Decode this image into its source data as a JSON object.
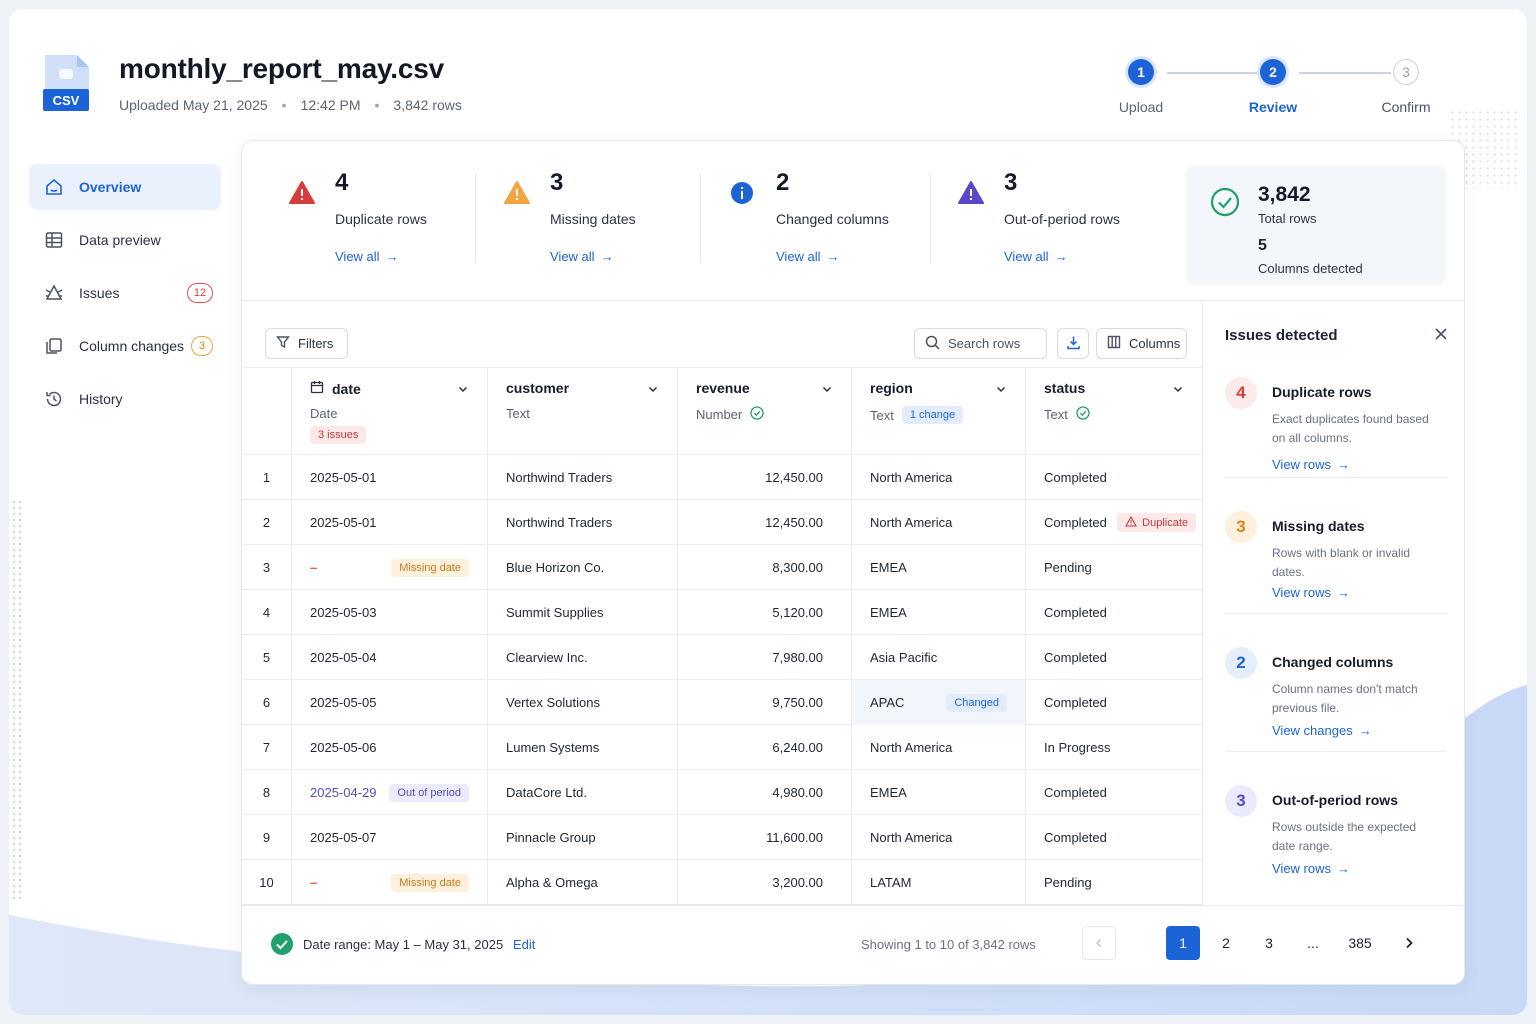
{
  "file": {
    "icon_label": "CSV",
    "name": "monthly_report_may.csv",
    "uploaded": "Uploaded May 21, 2025",
    "time": "12:42 PM",
    "rows": "3,842 rows",
    "separator": "•"
  },
  "stepper": [
    {
      "num": "1",
      "label": "Upload",
      "state": "done"
    },
    {
      "num": "2",
      "label": "Review",
      "state": "active"
    },
    {
      "num": "3",
      "label": "Confirm",
      "state": "todo"
    }
  ],
  "sidebar": {
    "items": [
      {
        "label": "Overview",
        "icon": "home-icon",
        "active": true
      },
      {
        "label": "Data preview",
        "icon": "table-icon"
      },
      {
        "label": "Issues",
        "icon": "bug-icon",
        "badge": "12"
      },
      {
        "label": "Column changes",
        "icon": "copy-icon",
        "badge": "3"
      },
      {
        "label": "History",
        "icon": "history-icon"
      }
    ]
  },
  "summary": {
    "stats": [
      {
        "value": "4",
        "label": "Duplicate rows",
        "link": "View all",
        "icon": "warning-red-icon",
        "color": "#d83b3b"
      },
      {
        "value": "3",
        "label": "Missing dates",
        "link": "View all",
        "icon": "warning-orange-icon",
        "color": "#f0a540"
      },
      {
        "value": "2",
        "label": "Changed columns",
        "link": "View all",
        "icon": "info-blue-icon",
        "color": "#1d63d8"
      },
      {
        "value": "3",
        "label": "Out-of-period rows",
        "link": "View all",
        "icon": "warning-purple-icon",
        "color": "#5b45c9"
      }
    ],
    "total": {
      "value": "3,842",
      "label": "Total rows",
      "value2": "5",
      "label2": "Columns detected"
    }
  },
  "toolbar": {
    "filters": "Filters",
    "search_placeholder": "Search rows",
    "columns": "Columns"
  },
  "table": {
    "columns": [
      {
        "name": "date",
        "type": "Date",
        "tag": "3 issues"
      },
      {
        "name": "customer",
        "type": "Text"
      },
      {
        "name": "revenue",
        "type": "Number"
      },
      {
        "name": "region",
        "type": "Text",
        "tag": "1 change"
      },
      {
        "name": "status",
        "type": "Text"
      }
    ],
    "rows": [
      {
        "idx": "1",
        "date": "2025-05-01",
        "customer": "Northwind Traders",
        "revenue": "12,450.00",
        "region": "North America",
        "status": "Completed"
      },
      {
        "idx": "2",
        "date": "2025-05-01",
        "customer": "Northwind Traders",
        "revenue": "12,450.00",
        "region": "North America",
        "status": "Completed",
        "status_tag": "Duplicate"
      },
      {
        "idx": "3",
        "date": "–",
        "date_tag": "Missing date",
        "customer": "Blue Horizon Co.",
        "revenue": "8,300.00",
        "region": "EMEA",
        "status": "Pending"
      },
      {
        "idx": "4",
        "date": "2025-05-03",
        "customer": "Summit Supplies",
        "revenue": "5,120.00",
        "region": "EMEA",
        "status": "Completed"
      },
      {
        "idx": "5",
        "date": "2025-05-04",
        "customer": "Clearview Inc.",
        "revenue": "7,980.00",
        "region": "Asia Pacific",
        "status": "Completed"
      },
      {
        "idx": "6",
        "date": "2025-05-05",
        "customer": "Vertex Solutions",
        "revenue": "9,750.00",
        "region": "APAC",
        "region_tag": "Changed",
        "status": "Completed"
      },
      {
        "idx": "7",
        "date": "2025-05-06",
        "customer": "Lumen Systems",
        "revenue": "6,240.00",
        "region": "North America",
        "status": "In Progress"
      },
      {
        "idx": "8",
        "date": "2025-04-29",
        "date_tag": "Out of period",
        "customer": "DataCore Ltd.",
        "revenue": "4,980.00",
        "region": "EMEA",
        "status": "Completed"
      },
      {
        "idx": "9",
        "date": "2025-05-07",
        "customer": "Pinnacle Group",
        "revenue": "11,600.00",
        "region": "North America",
        "status": "Completed"
      },
      {
        "idx": "10",
        "date": "–",
        "date_tag": "Missing date",
        "customer": "Alpha & Omega",
        "revenue": "3,200.00",
        "region": "LATAM",
        "status": "Pending"
      }
    ]
  },
  "panel": {
    "title": "Issues detected",
    "issues": [
      {
        "count": "4",
        "title": "Duplicate rows",
        "desc": "Exact duplicates found based on all columns.",
        "link": "View rows",
        "color": "#d83b3b",
        "bg": "#fdeaea"
      },
      {
        "count": "3",
        "title": "Missing dates",
        "desc": "Rows with blank or invalid dates.",
        "link": "View rows",
        "color": "#d88616",
        "bg": "#fdf1de"
      },
      {
        "count": "2",
        "title": "Changed columns",
        "desc": "Column names don't match previous file.",
        "link": "View changes",
        "color": "#1d63d8",
        "bg": "#e6eefc"
      },
      {
        "count": "3",
        "title": "Out-of-period rows",
        "desc": "Rows outside the expected date range.",
        "link": "View rows",
        "color": "#4f4fc3",
        "bg": "#ecebfd"
      }
    ]
  },
  "footer": {
    "date_range": "Date range: May 1 – May 31, 2025",
    "edit": "Edit",
    "showing": "Showing 1 to 10 of 3,842 rows",
    "pages": [
      "1",
      "2",
      "3",
      "...",
      "385"
    ]
  }
}
